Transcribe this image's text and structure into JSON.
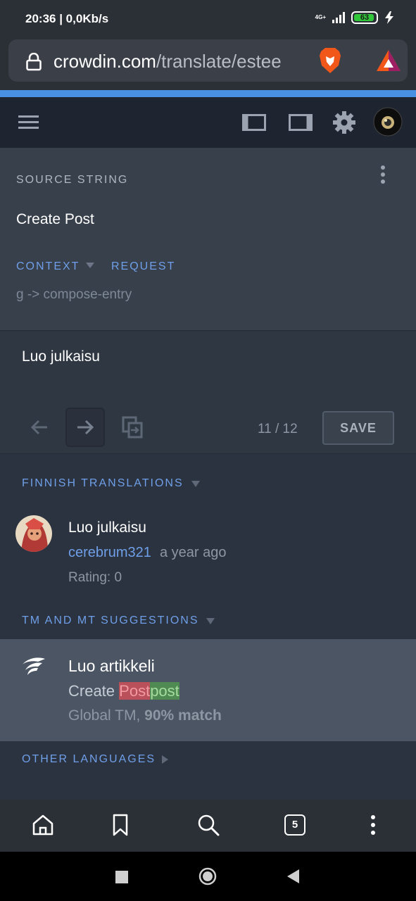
{
  "status_bar": {
    "time": "20:36 | 0,0Kb/s",
    "network": "4G+",
    "battery": "63"
  },
  "browser": {
    "url_domain": "crowdin.com",
    "url_path": "/translate/estee",
    "tab_count": "5",
    "progress_color": "#4a90e2"
  },
  "source": {
    "title": "SOURCE STRING",
    "string": "Create Post",
    "context_label": "CONTEXT",
    "request_label": "REQUEST",
    "context_value": "g -> compose-entry"
  },
  "editor": {
    "translation": "Luo julkaisu",
    "counter": "11 / 12",
    "save_label": "SAVE"
  },
  "finnish": {
    "title": "FINNISH TRANSLATIONS",
    "text": "Luo julkaisu",
    "author": "cerebrum321",
    "time": "a year ago",
    "rating": "Rating: 0"
  },
  "suggestions": {
    "title": "TM AND MT SUGGESTIONS",
    "text": "Luo artikkeli",
    "source_prefix": "Create ",
    "source_deleted": "Post",
    "source_inserted": "post",
    "match_source": "Global TM, ",
    "match_value": "90% match"
  },
  "other": {
    "title": "OTHER LANGUAGES"
  },
  "colors": {
    "accent": "#6f9fe8",
    "diff_deleted": "#b9505a",
    "diff_inserted": "#4f8a52"
  }
}
